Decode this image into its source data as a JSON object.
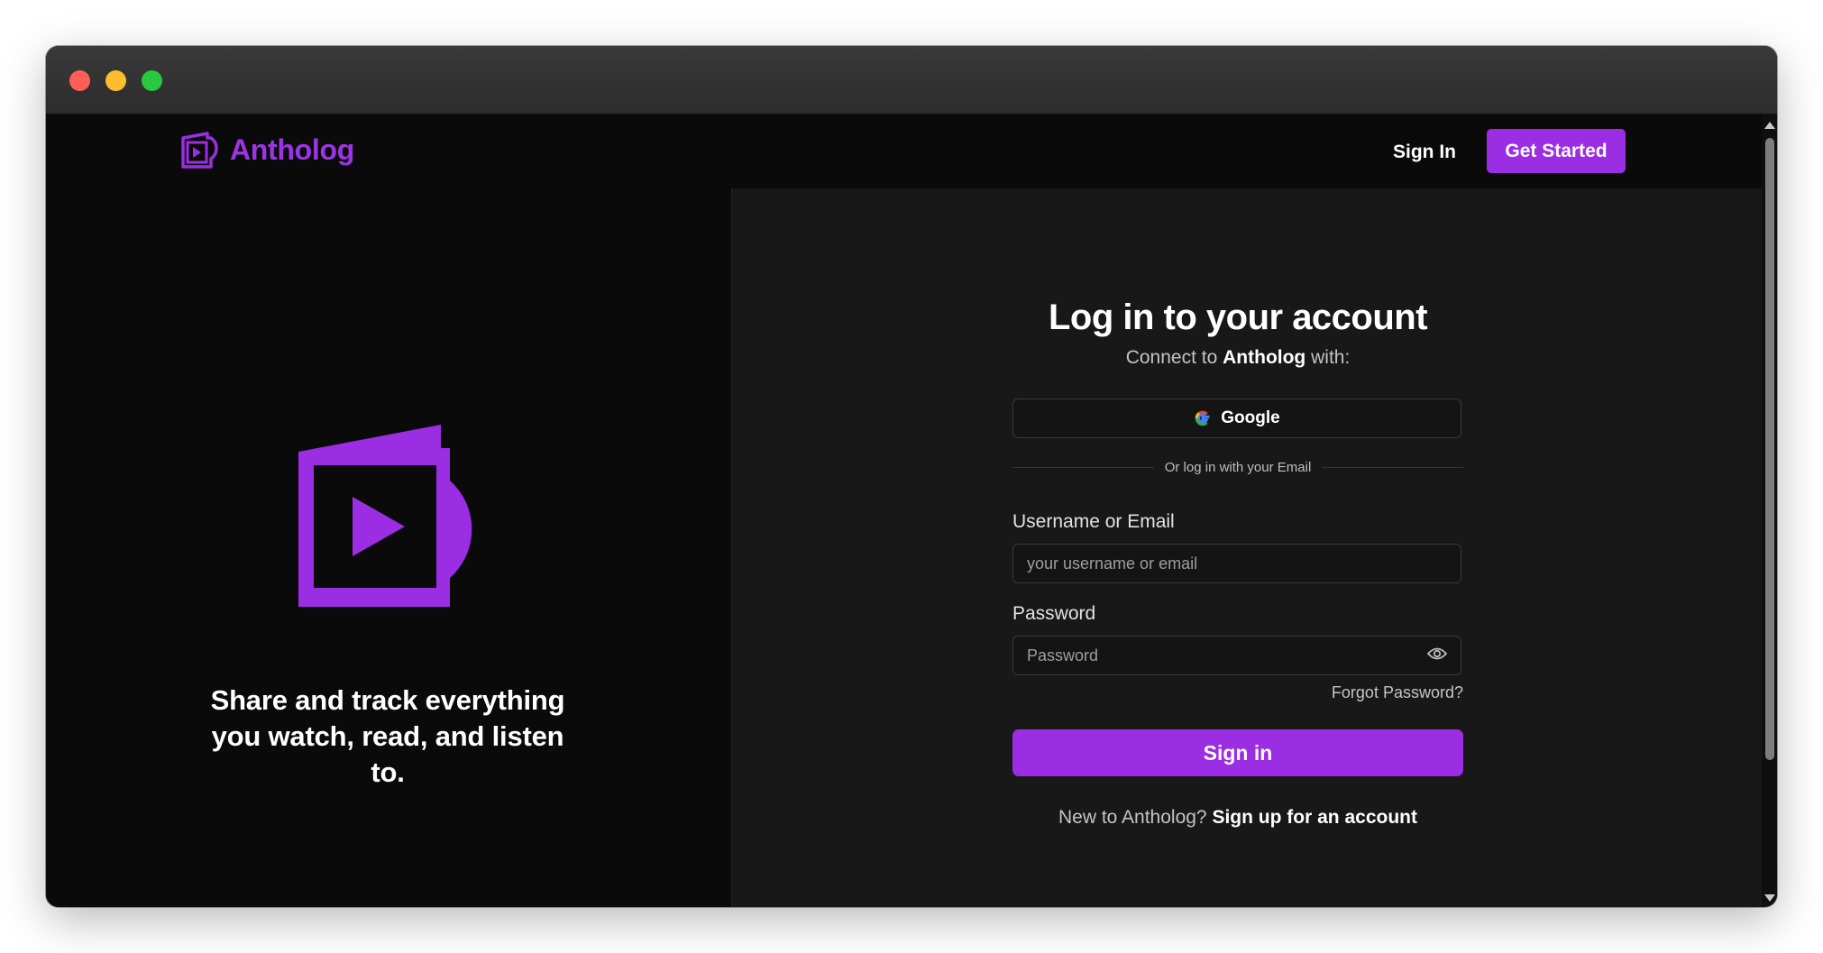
{
  "brand": {
    "name": "Antholog",
    "color": "#9b2de3"
  },
  "nav": {
    "sign_in": "Sign In",
    "get_started": "Get Started"
  },
  "hero": {
    "tagline": "Share and track everything you watch, read, and listen to."
  },
  "login": {
    "title": "Log in to your account",
    "subtitle_prefix": "Connect to",
    "subtitle_brand": "Antholog",
    "subtitle_suffix": "with:",
    "google_label": "Google",
    "divider_text": "Or log in with your Email",
    "username_label": "Username or Email",
    "username_placeholder": "your username or email",
    "password_label": "Password",
    "password_placeholder": "Password",
    "forgot_password": "Forgot Password?",
    "submit_label": "Sign in",
    "signup_prompt": "New to Antholog?",
    "signup_link": "Sign up for an account"
  },
  "icons": {
    "logo": "antholog-logo-icon",
    "google": "google-g-icon",
    "password_toggle": "eye-icon"
  }
}
